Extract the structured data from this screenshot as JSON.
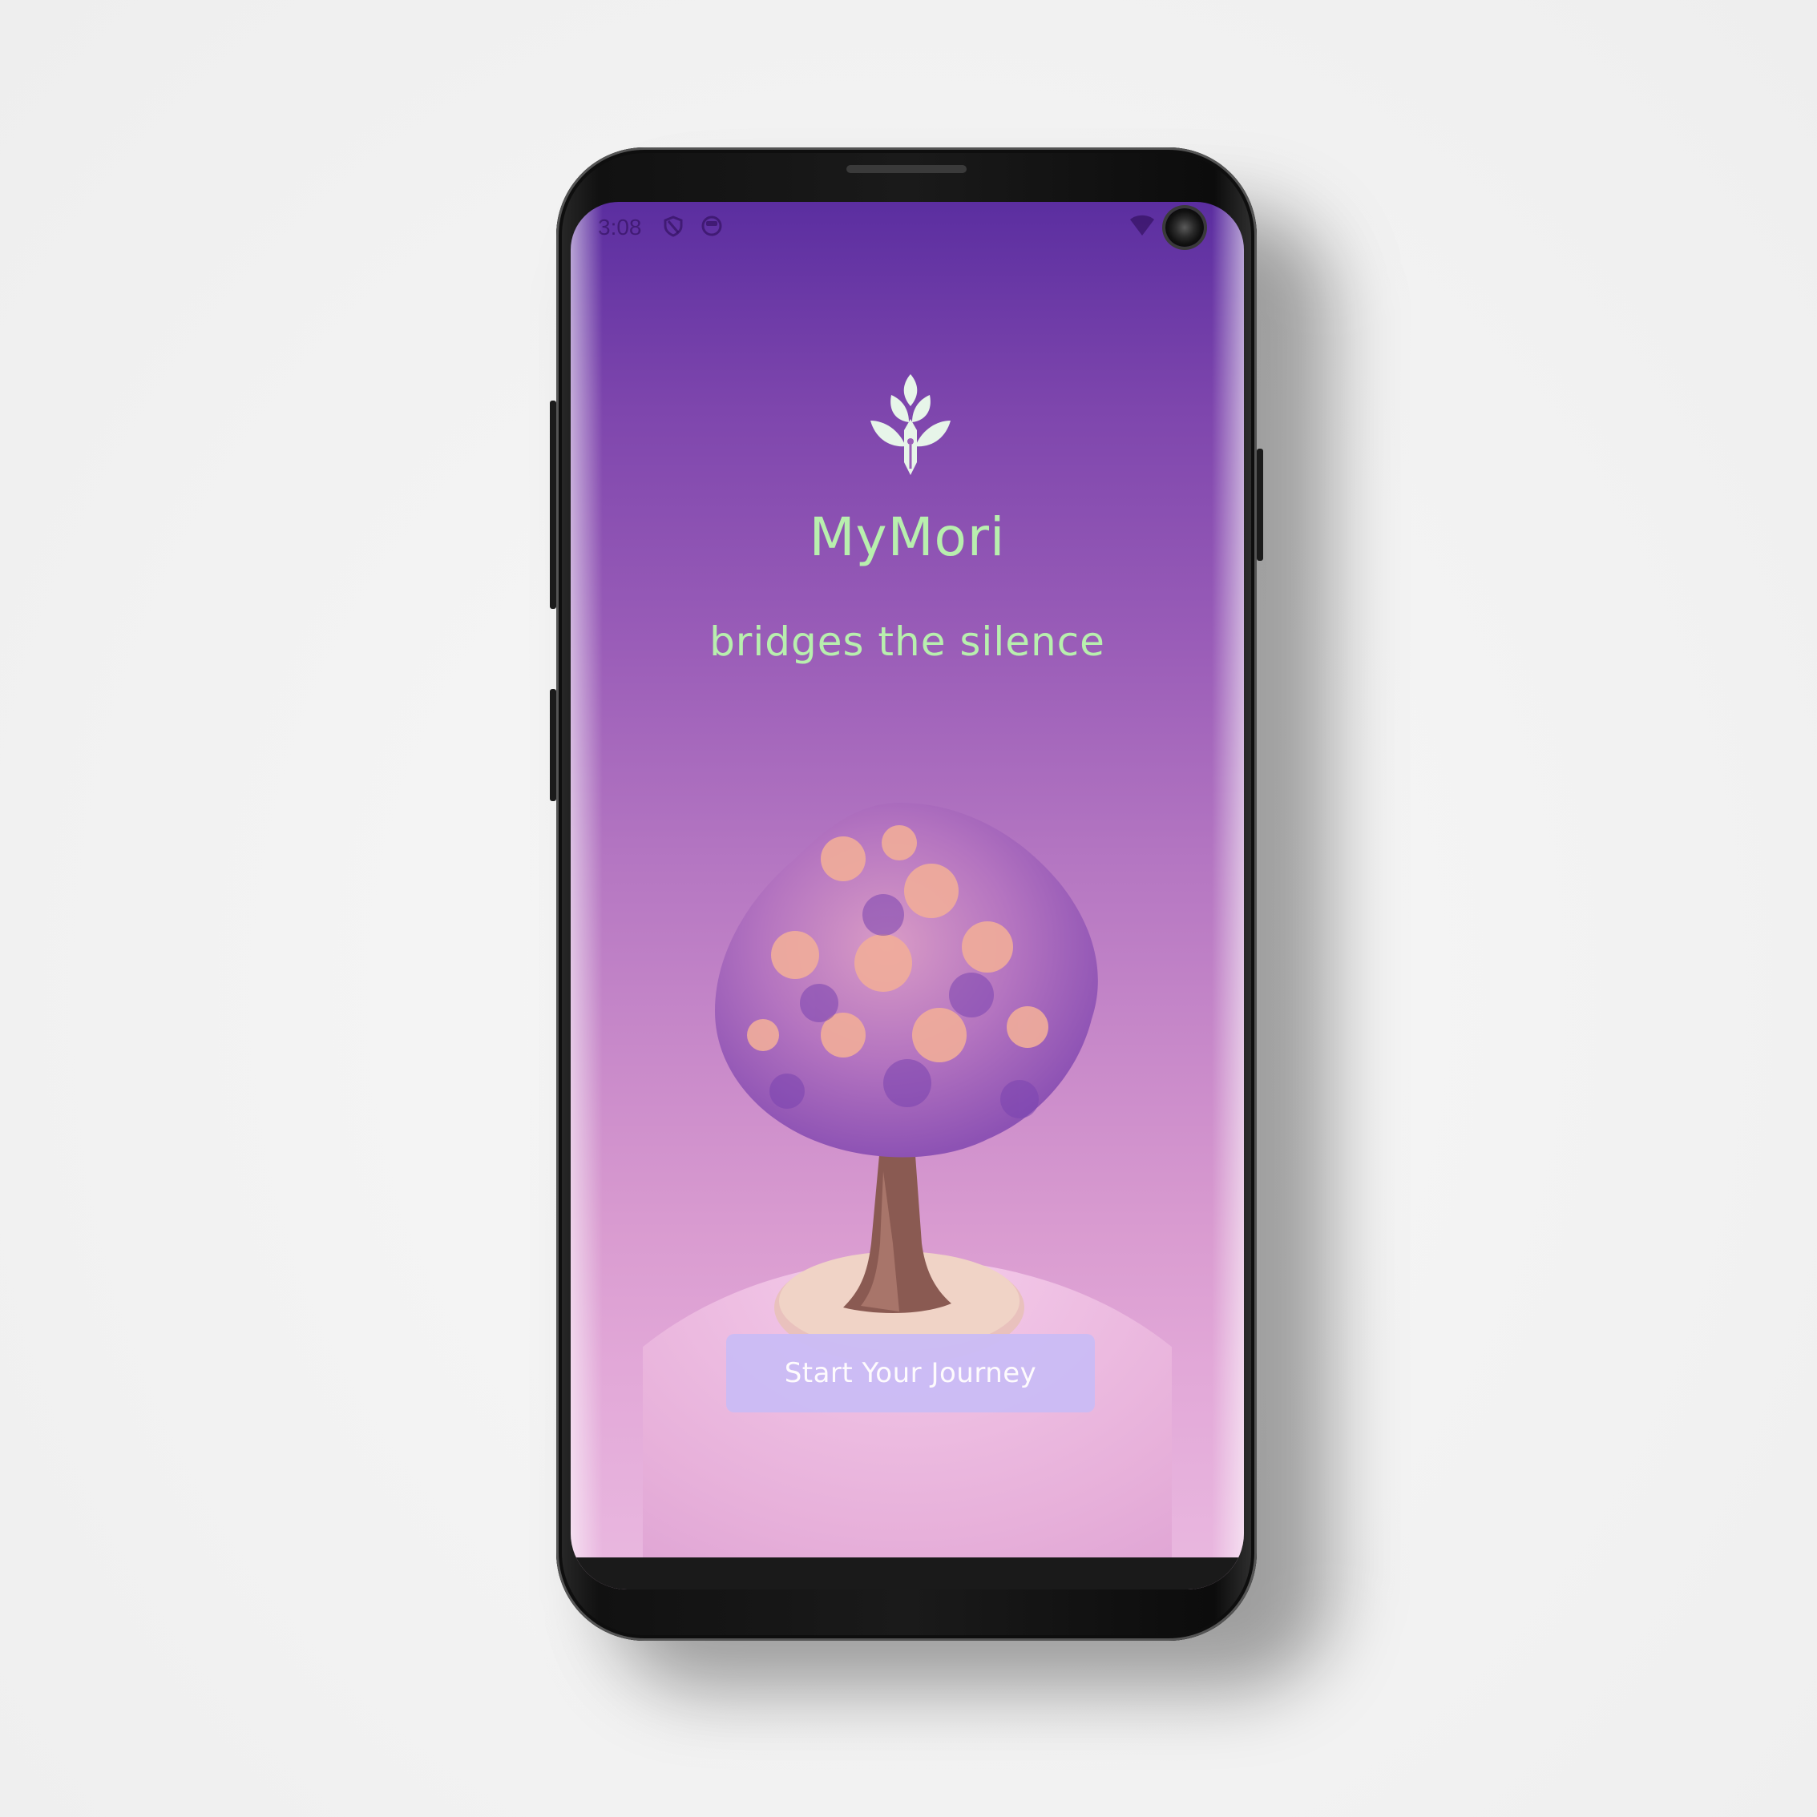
{
  "status_bar": {
    "time": "3:08",
    "left_icons": [
      "shield-icon",
      "face-icon"
    ],
    "right_icons": [
      "wifi-icon",
      "camera-lens"
    ]
  },
  "app": {
    "logo_icon": "sprout-pen-icon",
    "title": "MyMori",
    "tagline": "bridges the silence",
    "illustration": "tree-illustration",
    "start_button_label": "Start Your Journey"
  },
  "colors": {
    "gradient_top": "#5b2ea0",
    "gradient_bottom": "#eab9e0",
    "title_green": "#b8efae",
    "button_bg": "#cbbcf6",
    "button_text": "#ffffff"
  }
}
